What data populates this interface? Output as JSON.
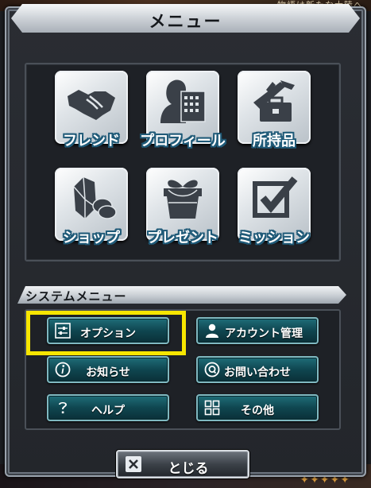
{
  "background": {
    "top_text": "物語は新たな大陸へ"
  },
  "dialog": {
    "title": "メニュー"
  },
  "icon_buttons": [
    {
      "label": "フレンド",
      "icon": "handshake-icon"
    },
    {
      "label": "プロフィール",
      "icon": "profile-icon"
    },
    {
      "label": "所持品",
      "icon": "inventory-icon"
    },
    {
      "label": "ショップ",
      "icon": "gem-coins-icon"
    },
    {
      "label": "プレゼント",
      "icon": "gift-icon"
    },
    {
      "label": "ミッション",
      "icon": "checkbox-icon"
    }
  ],
  "system_menu": {
    "title": "システムメニュー",
    "buttons": [
      {
        "label": "オプション",
        "icon": "settings-sliders-icon"
      },
      {
        "label": "アカウント管理",
        "icon": "user-icon"
      },
      {
        "label": "お知らせ",
        "icon": "info-icon"
      },
      {
        "label": "お問い合わせ",
        "icon": "question-bubble-icon"
      },
      {
        "label": "ヘルプ",
        "icon": "help-icon"
      },
      {
        "label": "その他",
        "icon": "grid-icon"
      }
    ]
  },
  "close_button": {
    "label": "とじる",
    "icon": "close-icon"
  },
  "highlight_color": "#f7e600",
  "accent_teal": "#0f4650"
}
